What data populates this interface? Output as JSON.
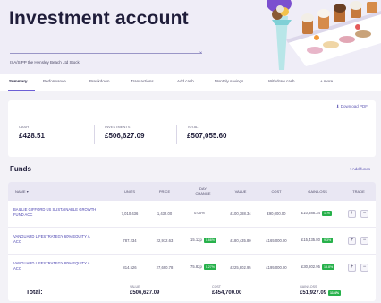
{
  "page": {
    "title": "Investment account",
    "subtitle": "ISA/SIPP the Hensley Beach Ltd Stock"
  },
  "tabs": [
    {
      "label": "Summary",
      "active": true
    },
    {
      "label": "Performance",
      "active": false
    },
    {
      "label": "Breakdown",
      "active": false
    },
    {
      "label": "Transactions",
      "active": false
    },
    {
      "label": "Add cash",
      "active": false
    },
    {
      "label": "Monthly savings",
      "active": false
    },
    {
      "label": "Withdraw cash",
      "active": false
    },
    {
      "label": "+ more",
      "active": false
    }
  ],
  "summary": {
    "download_label": "Download PDF",
    "stats": [
      {
        "label": "Cash",
        "value": "£428.51"
      },
      {
        "label": "Investments",
        "value": "£506,627.09"
      },
      {
        "label": "Total",
        "value": "£507,055.60"
      }
    ]
  },
  "funds": {
    "title": "Funds",
    "add_label": "+ Add funds",
    "columns": [
      "Name",
      "Units",
      "Price",
      "Day change",
      "Value",
      "Cost",
      "Gain/Loss",
      "Trade"
    ],
    "rows": [
      {
        "name": "Baillie Gifford US Sustainable Growth Fund Acc",
        "units": "7,010.436",
        "price": "1,432.00",
        "day_change": "0.00%",
        "day_badge": "",
        "value": "£100,388.34",
        "cost": "£90,000.00",
        "gain": "£10,388.34",
        "gain_badge": "11%"
      },
      {
        "name": "Vanguard LifeStrategy 60% Equity A Acc",
        "units": "787.234",
        "price": "22,912.63",
        "day_change": "15.12p",
        "day_badge": "0.66%",
        "value": "£180,435.80",
        "cost": "£165,000.00",
        "gain": "£15,435.80",
        "gain_badge": "9.3%"
      },
      {
        "name": "Vanguard LifeStrategy 80% Equity A Acc",
        "units": "814.526",
        "price": "27,690.78",
        "day_change": "75.82p",
        "day_badge": "0.27%",
        "value": "£225,802.95",
        "cost": "£195,000.00",
        "gain": "£30,802.95",
        "gain_badge": "15.8%"
      }
    ],
    "trade_buttons": [
      "+",
      "−"
    ],
    "total": {
      "label": "Total:",
      "value_label": "Value",
      "value": "£506,627.09",
      "cost_label": "Cost",
      "cost": "£454,700.00",
      "gain_label": "Gain/Loss",
      "gain": "£51,927.09",
      "gain_badge": "11.4%"
    }
  },
  "colors": {
    "accent": "#6c5fd6",
    "link": "#4a43b0",
    "positive": "#27b14b",
    "hero_bg": "#efedf7"
  }
}
